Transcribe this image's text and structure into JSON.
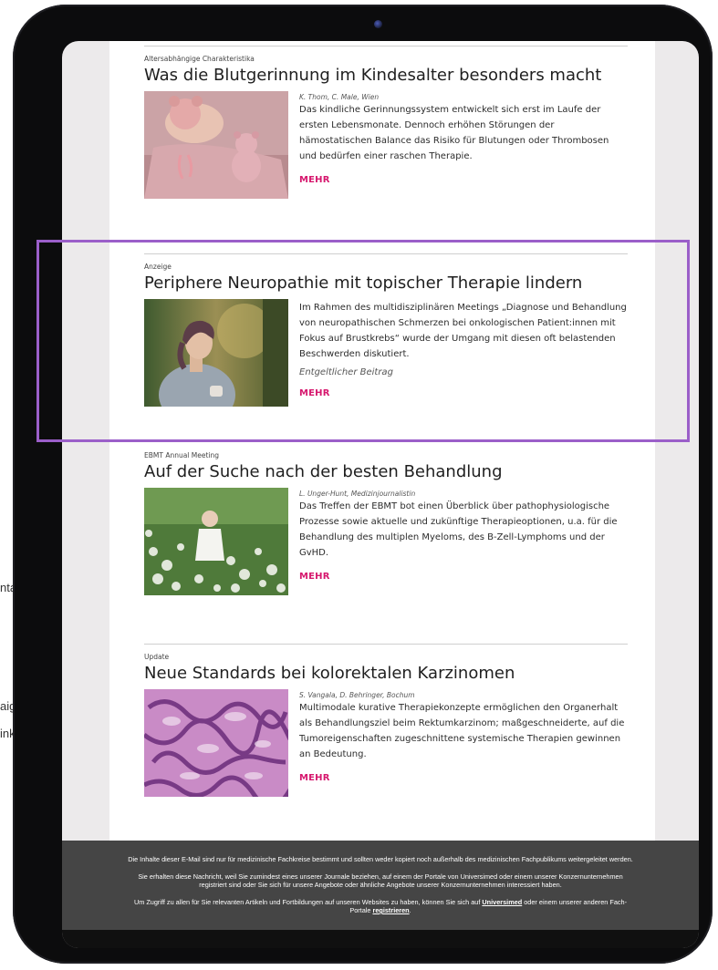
{
  "side_fragments": [
    "nta",
    "aig",
    "ink"
  ],
  "articles": [
    {
      "category": "Altersabhängige Charakteristika",
      "headline": "Was die Blutgerinnung im Kindesalter besonders macht",
      "authors": "K. Thom, C. Male, Wien",
      "teaser": "Das kindliche Gerinnungssystem entwickelt sich erst im Laufe der ersten Lebensmonate. Dennoch erhöhen Störungen der hämostatischen Balance das Risiko für Blutungen oder Thrombosen und bedürfen einer raschen Therapie.",
      "more": "MEHR"
    },
    {
      "category": "Anzeige",
      "headline": "Periphere Neuropathie mit topischer Therapie lindern",
      "teaser": "Im Rahmen des multidisziplinären Meetings „Diagnose und Behandlung von neuropathischen Schmerzen bei onkologischen Patient:innen mit Fokus auf Brustkrebs“ wurde der Umgang mit diesen oft belastenden Beschwerden diskutiert.",
      "sponsored": "Entgeltlicher Beitrag",
      "more": "MEHR"
    },
    {
      "category": "EBMT Annual Meeting",
      "headline": "Auf der Suche nach der besten Behandlung",
      "authors": "L. Unger-Hunt, Medizinjournalistin",
      "teaser": "Das Treffen der EBMT bot einen Überblick über pathophysiologische Prozesse sowie aktuelle und zukünftige Therapieoptionen, u.a. für die Behandlung des multiplen Myeloms, des B-Zell-Lymphoms und der GvHD.",
      "more": "MEHR"
    },
    {
      "category": "Update",
      "headline": "Neue Standards bei kolorektalen Karzinomen",
      "authors": "S. Vangala, D. Behringer, Bochum",
      "teaser": "Multimodale kurative Therapiekonzepte ermöglichen den Organerhalt als Behandlungsziel beim Rektumkarzinom; maßgeschneiderte, auf die Tumoreigenschaften zugeschnittene systemische Therapien gewinnen an Bedeutung.",
      "more": "MEHR"
    }
  ],
  "footer": {
    "p1": "Die Inhalte dieser E-Mail sind nur für medizinische Fachkreise bestimmt und sollten weder kopiert noch außerhalb des medizinischen Fachpublikums weitergeleitet werden.",
    "p2": "Sie erhalten diese Nachricht, weil Sie zumindest eines unserer Journale beziehen, auf einem der Portale von Universimed oder einem unserer Konzernunternehmen registriert sind oder Sie sich für unsere Angebote oder ähnliche Angebote unserer Konzernunternehmen interessiert haben.",
    "p3_before": "Um Zugriff zu allen für Sie relevanten Artikeln und Fortbildungen auf unseren Websites zu haben, können Sie sich auf",
    "p3_link1": "Universimed",
    "p3_middle": "oder einem unserer anderen Fach-Portale",
    "p3_link2": "registrieren",
    "p3_end": "."
  },
  "colors": {
    "accent": "#d6186e",
    "highlight_box": "#9b5fc9",
    "footer_bg": "#454545"
  }
}
